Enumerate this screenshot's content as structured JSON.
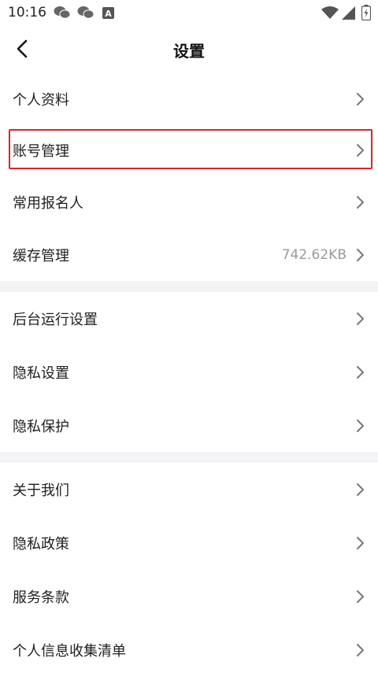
{
  "status_bar": {
    "time": "10:16",
    "icons": [
      "wechat-icon",
      "wechat-icon",
      "font-a-icon",
      "wifi-icon",
      "signal-icon",
      "battery-icon"
    ]
  },
  "nav": {
    "title": "设置",
    "back_icon": "chevron-left-icon"
  },
  "groups": [
    {
      "items": [
        {
          "label": "个人资料",
          "value": ""
        },
        {
          "label": "账号管理",
          "value": "",
          "highlighted": true
        },
        {
          "label": "常用报名人",
          "value": ""
        },
        {
          "label": "缓存管理",
          "value": "742.62KB"
        }
      ]
    },
    {
      "items": [
        {
          "label": "后台运行设置",
          "value": ""
        },
        {
          "label": "隐私设置",
          "value": ""
        },
        {
          "label": "隐私保护",
          "value": ""
        }
      ]
    },
    {
      "items": [
        {
          "label": "关于我们",
          "value": ""
        },
        {
          "label": "隐私政策",
          "value": ""
        },
        {
          "label": "服务条款",
          "value": ""
        },
        {
          "label": "个人信息收集清单",
          "value": ""
        }
      ]
    }
  ],
  "colors": {
    "highlight_border": "#d62828",
    "section_gap": "#f4f4f6",
    "value_text": "#9a9a9a"
  }
}
